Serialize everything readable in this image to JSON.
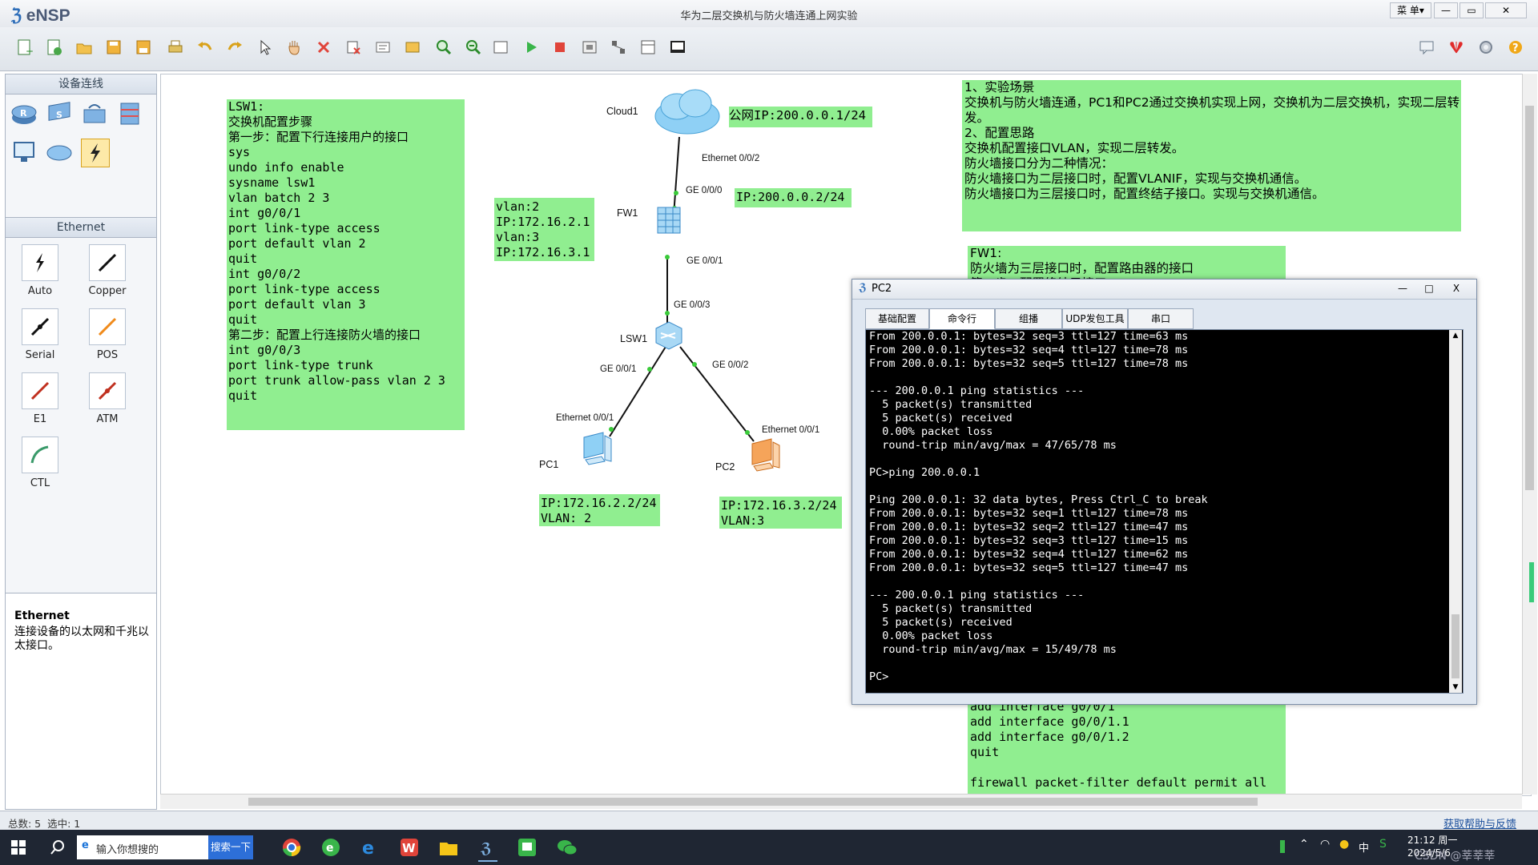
{
  "window": {
    "app_name": "eNSP",
    "title": "华为二层交换机与防火墙连通上网实验",
    "menu_label": "菜 单▾",
    "minimize": "—",
    "restore": "▭",
    "close": "✕"
  },
  "left_panel": {
    "devices_header": "设备连线",
    "ethernet_header": "Ethernet",
    "connections": [
      {
        "label": "Auto"
      },
      {
        "label": "Copper"
      },
      {
        "label": "Serial"
      },
      {
        "label": "POS"
      },
      {
        "label": "E1"
      },
      {
        "label": "ATM"
      },
      {
        "label": "CTL"
      }
    ],
    "desc_title": "Ethernet",
    "desc_text": "连接设备的以太网和千兆以太接口。"
  },
  "notes": {
    "lsw1": "LSW1:\n交换机配置步骤\n第一步：配置下行连接用户的接口\nsys\nundo info enable\nsysname lsw1\nvlan batch 2 3\nint g0/0/1\nport link-type access\nport default vlan 2\nquit\nint g0/0/2\nport link-type access\nport default vlan 3\nquit\n第二步：配置上行连接防火墙的接口\nint g0/0/3\nport link-type trunk\nport trunk allow-pass vlan 2 3\nquit",
    "fw_vlan": "vlan:2\nIP:172.16.2.1\nvlan:3\nIP:172.16.3.1",
    "public_ip": "公网IP:200.0.0.1/24",
    "fw_ip": "IP:200.0.0.2/24",
    "pc1_ip": "IP:172.16.2.2/24\nVLAN: 2",
    "pc2_ip": "IP:172.16.3.2/24\nVLAN:3",
    "scenario": [
      "1、实验场景",
      "交换机与防火墙连通，PC1和PC2通过交换机实现上网，交换机为二层交换机，实现二层转发。",
      "2、配置思路",
      "交换机配置接口VLAN，实现二层转发。",
      "防火墙接口分为二种情况：",
      "防火墙接口为二层接口时，配置VLANIF，实现与交换机通信。",
      "防火墙接口为三层接口时，配置终结子接口。实现与交换机通信。"
    ],
    "fw1_top": "FW1:\n防火墙为三层接口时，配置路由器的接口\n第一步：配置终结子接口",
    "fw1_bottom": "add interface g0/0/1\nadd interface g0/0/1.1\nadd interface g0/0/1.2\nquit\n\nfirewall packet-filter default permit all"
  },
  "topology": {
    "devices": {
      "cloud": "Cloud1",
      "fw": "FW1",
      "lsw": "LSW1",
      "pc1": "PC1",
      "pc2": "PC2"
    },
    "ports": {
      "cloud_eth": "Ethernet 0/0/2",
      "fw_ge00": "GE 0/0/0",
      "fw_ge01": "GE 0/0/1",
      "lsw_ge03": "GE 0/0/3",
      "lsw_ge01": "GE 0/0/1",
      "lsw_ge02": "GE 0/0/2",
      "pc1_eth": "Ethernet 0/0/1",
      "pc2_eth": "Ethernet 0/0/1"
    }
  },
  "pc2_window": {
    "title": "PC2",
    "tabs": [
      "基础配置",
      "命令行",
      "组播",
      "UDP发包工具",
      "串口"
    ],
    "active_tab": "命令行",
    "min": "—",
    "max": "□",
    "close": "X",
    "terminal": "From 200.0.0.1: bytes=32 seq=3 ttl=127 time=63 ms\nFrom 200.0.0.1: bytes=32 seq=4 ttl=127 time=78 ms\nFrom 200.0.0.1: bytes=32 seq=5 ttl=127 time=78 ms\n\n--- 200.0.0.1 ping statistics ---\n  5 packet(s) transmitted\n  5 packet(s) received\n  0.00% packet loss\n  round-trip min/avg/max = 47/65/78 ms\n\nPC>ping 200.0.0.1\n\nPing 200.0.0.1: 32 data bytes, Press Ctrl_C to break\nFrom 200.0.0.1: bytes=32 seq=1 ttl=127 time=78 ms\nFrom 200.0.0.1: bytes=32 seq=2 ttl=127 time=47 ms\nFrom 200.0.0.1: bytes=32 seq=3 ttl=127 time=15 ms\nFrom 200.0.0.1: bytes=32 seq=4 ttl=127 time=62 ms\nFrom 200.0.0.1: bytes=32 seq=5 ttl=127 time=47 ms\n\n--- 200.0.0.1 ping statistics ---\n  5 packet(s) transmitted\n  5 packet(s) received\n  0.00% packet loss\n  round-trip min/avg/max = 15/49/78 ms\n\nPC>"
  },
  "status": {
    "summary": "总数: 5  选中: 1",
    "help_link": "获取帮助与反馈"
  },
  "taskbar": {
    "search_placeholder": "输入你想搜的",
    "search_button": "搜索一下",
    "time": "21:12 周一",
    "date": "2024/5/6",
    "ime": "中",
    "watermark": "CSDN @莘莘莘"
  },
  "colors": {
    "note_green": "#90ee90",
    "terminal_bg": "#000000",
    "terminal_fg": "#ffffff"
  }
}
